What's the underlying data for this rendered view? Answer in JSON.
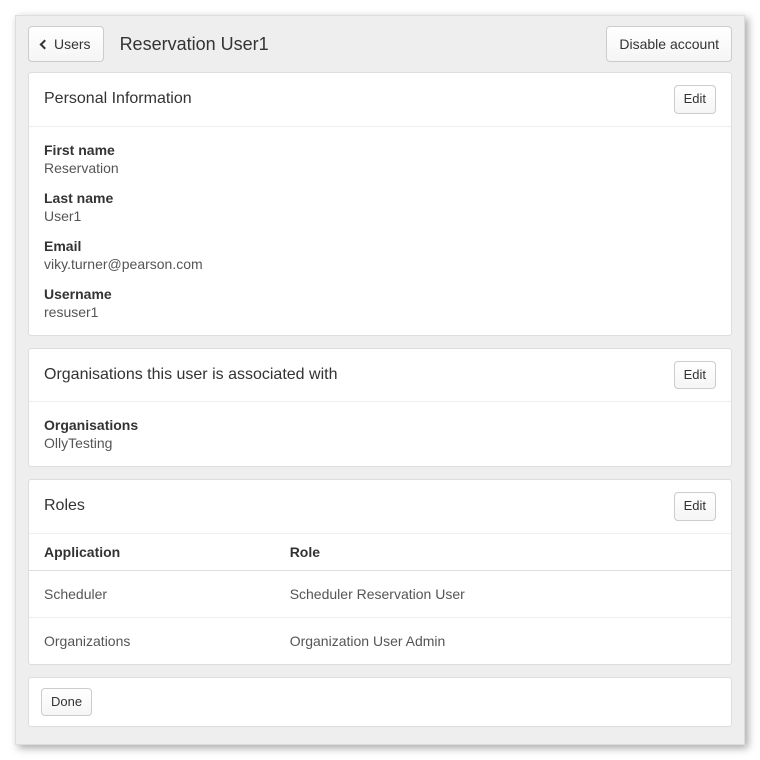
{
  "header": {
    "back_label": "Users",
    "title": "Reservation User1",
    "disable_label": "Disable account"
  },
  "personal": {
    "heading": "Personal Information",
    "edit_label": "Edit",
    "fields": {
      "first_name_label": "First name",
      "first_name_value": "Reservation",
      "last_name_label": "Last name",
      "last_name_value": "User1",
      "email_label": "Email",
      "email_value": "viky.turner@pearson.com",
      "username_label": "Username",
      "username_value": "resuser1"
    }
  },
  "orgs": {
    "heading": "Organisations this user is associated with",
    "edit_label": "Edit",
    "field_label": "Organisations",
    "field_value": "OllyTesting"
  },
  "roles": {
    "heading": "Roles",
    "edit_label": "Edit",
    "col_app": "Application",
    "col_role": "Role",
    "rows": [
      {
        "application": "Scheduler",
        "role": "Scheduler Reservation User"
      },
      {
        "application": "Organizations",
        "role": "Organization User Admin"
      }
    ]
  },
  "footer": {
    "done_label": "Done"
  }
}
